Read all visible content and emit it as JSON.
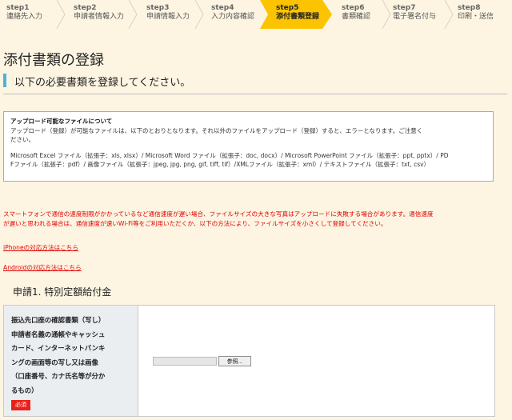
{
  "steps": [
    {
      "num": "step1",
      "label": "連絡先入力"
    },
    {
      "num": "step2",
      "label": "申請者情報入力"
    },
    {
      "num": "step3",
      "label": "申請情報入力"
    },
    {
      "num": "step4",
      "label": "入力内容確認"
    },
    {
      "num": "step5",
      "label": "添付書類登録"
    },
    {
      "num": "step6",
      "label": "書類確認"
    },
    {
      "num": "step7",
      "label": "電子署名付与"
    },
    {
      "num": "step8",
      "label": "印刷・送信"
    }
  ],
  "colors": {
    "active_step": "#fcc400",
    "accent_bar": "#4fb3d8",
    "warning": "#e00000",
    "required": "#e8221c"
  },
  "page_title": "添付書類の登録",
  "subheading": "以下の必要書類を登録してください。",
  "notice": {
    "heading": "アップロード可能なファイルについて",
    "line1": "アップロード（登録）が可能なファイルは、以下のとおりとなります。それ以外のファイルをアップロード（登録）すると、エラーとなります。ご注意く",
    "line2": "ださい。",
    "line3": "Microsoft Excel ファイル（拡張子：xls, xlsx）/ Microsoft Word ファイル（拡張子：doc, docx）/ Microsoft PowerPoint ファイル（拡張子：ppt, pptx）/ PD",
    "line4": "Fファイル（拡張子：pdf）/ 画像ファイル（拡張子：jpeg, jpg, png, gif, tiff, tif）/XMLファイル（拡張子：xml）/ テキストファイル（拡張子：txt, csv）"
  },
  "warning": {
    "line1": "スマートフォンで通信の速度制限がかかっているなど通信速度が遅い場合、ファイルサイズの大きな写真はアップロードに失敗する場合があります。通信速度",
    "line2": "が遅いと思われる場合は、通信速度が速いWi-Fi等をご利用いただくか、以下の方法により、ファイルサイズを小さくして登録してください。"
  },
  "links": {
    "iphone": "iPhoneの対応方法はこちら",
    "android": "Androidの対応方法はこちら"
  },
  "section_title": "申請1. 特別定額給付金",
  "document": {
    "label_lines": [
      "振込先口座の確認書類（写し）",
      "申請者名義の通帳やキャッシュ",
      "カード、インターネットバンキ",
      "ングの画面等の写し又は画像",
      "（口座番号、カナ氏名等が分か",
      "るもの）"
    ],
    "required_badge": "必須",
    "browse_label": "参照..."
  }
}
